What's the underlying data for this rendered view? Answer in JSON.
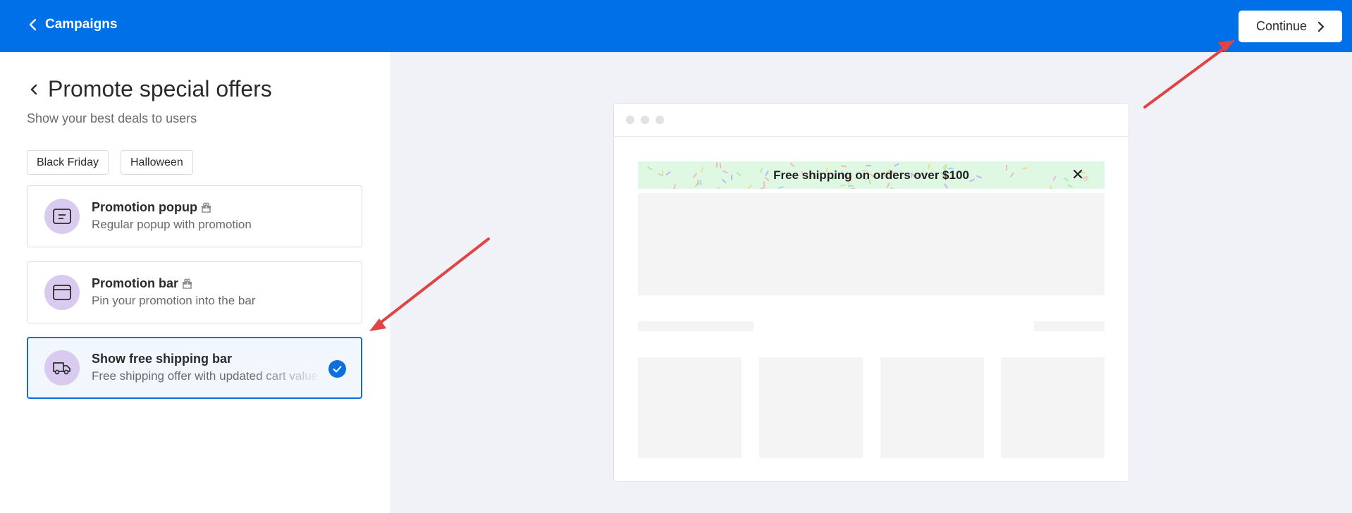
{
  "topbar": {
    "back_label": "Campaigns",
    "continue_label": "Continue",
    "bg_color": "#0070e8"
  },
  "panel": {
    "title": "Promote special offers",
    "subtitle": "Show your best deals to users",
    "tags": [
      "Black Friday",
      "Halloween"
    ]
  },
  "templates": [
    {
      "title": "Promotion popup",
      "desc": "Regular popup with promotion",
      "icon": "popup-icon",
      "has_gift": true,
      "selected": false
    },
    {
      "title": "Promotion bar",
      "desc": "Pin your promotion into the bar",
      "icon": "browser-window-icon",
      "has_gift": true,
      "selected": false
    },
    {
      "title": "Show free shipping bar",
      "desc": "Free shipping offer with updated cart value",
      "icon": "truck-icon",
      "has_gift": false,
      "selected": true
    }
  ],
  "preview": {
    "bar_text": "Free shipping on orders over $100",
    "bar_bg": "#dff8e4"
  },
  "colors": {
    "accent": "#0b6fe0",
    "icon_bg": "#d8cbef",
    "annotation_arrow": "#e04444"
  }
}
